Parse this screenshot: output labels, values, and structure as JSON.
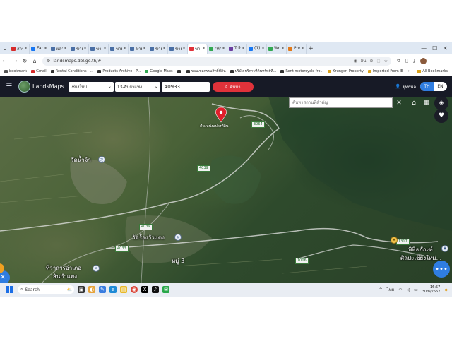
{
  "browser": {
    "tabs": [
      {
        "label": "สาร",
        "color": "#d62b2b"
      },
      {
        "label": "Face",
        "color": "#1877f2"
      },
      {
        "label": "ผลา",
        "color": "#4a6fa5"
      },
      {
        "label": "ขาย",
        "color": "#4a6fa5"
      },
      {
        "label": "ขาย",
        "color": "#4a6fa5"
      },
      {
        "label": "ขาย",
        "color": "#4a6fa5"
      },
      {
        "label": "ขาย",
        "color": "#4a6fa5"
      },
      {
        "label": "ขาย",
        "color": "#4a6fa5"
      },
      {
        "label": "ขาย",
        "color": "#4a6fa5"
      },
      {
        "label": "ขา",
        "color": "#e0323a"
      },
      {
        "label": "\"ที\"",
        "color": "#34a853"
      },
      {
        "label": "Tribe",
        "color": "#6b3fa0"
      },
      {
        "label": "(1)",
        "color": "#1877f2"
      },
      {
        "label": "Wro",
        "color": "#34a853"
      },
      {
        "label": "Pho",
        "color": "#e07a1c"
      }
    ],
    "active_tab_index": 9,
    "new_tab_label": "+",
    "url": "landsmaps.dol.go.th/#",
    "translate_label": "อิน",
    "bookmarks": [
      {
        "label": "bookmark",
        "color": "#555555"
      },
      {
        "label": "Gmail",
        "color": "#d62b2b"
      },
      {
        "label": "Rental Conditions - ...",
        "color": "#333333"
      },
      {
        "label": "Products Archive - P...",
        "color": "#333333"
      },
      {
        "label": "Google Maps",
        "color": "#34a853"
      },
      {
        "label": "",
        "color": "#333333"
      },
      {
        "label": "ขอบเขตกรรมสิทธิ์ที่ดิน",
        "color": "#333333"
      },
      {
        "label": "บริษัท บริการที่ดินทรัพย์ที่...",
        "color": "#333333"
      },
      {
        "label": "Rent motorcycle fro...",
        "color": "#333333"
      },
      {
        "label": "Krungsri Property",
        "color": "#d9a21b"
      },
      {
        "label": "Imported From IE",
        "color": "#d9a21b"
      }
    ],
    "bookmarks_more": "»",
    "all_bookmarks": "All Bookmarks"
  },
  "app": {
    "brand": "LandsMaps",
    "province": "เชียงใหม่",
    "district": "13-สันกำแพง",
    "parcel_number": "40933",
    "search_label": "ค้นหา",
    "user_name": "ยุทธพล",
    "lang_th": "TH",
    "lang_en": "EN"
  },
  "map": {
    "place_search_placeholder": "ค้นหาสถานที่สำคัญ",
    "marker_label": "ตำแหน่งแปลงที่ดิน",
    "places": {
      "wat_nam_cha": "วัดน้ำจ้า",
      "wat_rong_wua_daeng": "วัดร้องวัวแดง",
      "district_office": "ที่ว่าการอำเภอ",
      "district_office_2": "สันกำแพง",
      "moo3": "หมู่ 3",
      "museum": "พิพิธภัณฑ์",
      "museum_2": "ศิลปะเชียงใหม่..."
    },
    "roads": {
      "r3064": "3064",
      "r4039a": "4039",
      "r4039b": "4039",
      "r4033": "4033",
      "r1006": "1006",
      "r1317": "1317"
    }
  },
  "taskbar": {
    "search_label": "Search",
    "language": "ไทย",
    "time": "16:57",
    "date": "30/8/2567"
  }
}
